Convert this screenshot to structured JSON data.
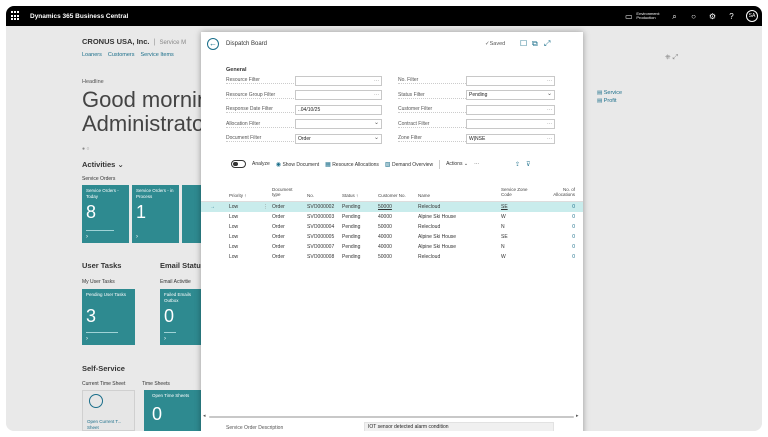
{
  "app": {
    "name": "Dynamics 365 Business Central",
    "environment_line1": "Environment:",
    "environment_line2": "Production",
    "avatar": "SA"
  },
  "background": {
    "company": "CRONUS USA, Inc.",
    "crumb": "Service M",
    "nav": [
      "Loaners",
      "Customers",
      "Service Items"
    ],
    "headline_label": "Headline",
    "greeting_line1": "Good mornin",
    "greeting_line2": "Administrator",
    "dots": "● ○",
    "activities": "Activities",
    "service_orders": "Service Orders",
    "tiles_service": [
      {
        "label": "Service Orders - Today",
        "value": "8"
      },
      {
        "label": "Service Orders - in Process",
        "value": "1"
      }
    ],
    "user_tasks": "User Tasks",
    "my_user_tasks": "My User Tasks",
    "pending_tile": {
      "label": "Pending User Tasks",
      "value": "3"
    },
    "email_status": "Email Statu",
    "email_activities": "Email Activitie",
    "failed_tile": {
      "label": "Failed Emails Outbox",
      "value": "0"
    },
    "self_service": "Self-Service",
    "current_time_sheet": "Current Time Sheet",
    "time_sheets": "Time Sheets",
    "open_current_tile": "Open Current T... Sheet",
    "open_time_tile": {
      "label": "Open Time Sheets",
      "value": "0"
    },
    "right_links": [
      "Service",
      "Profit"
    ]
  },
  "dispatch": {
    "title": "Dispatch Board",
    "saved": "✓Saved",
    "general": "General",
    "filters_left": [
      {
        "label": "Resource Filter",
        "value": "",
        "kind": "more"
      },
      {
        "label": "Resource Group Filter",
        "value": "",
        "kind": "more"
      },
      {
        "label": "Response Date Filter",
        "value": "..04/10/25",
        "kind": "none"
      },
      {
        "label": "Allocation Filter",
        "value": "",
        "kind": "dd"
      },
      {
        "label": "Document Filter",
        "value": "Order",
        "kind": "dd"
      }
    ],
    "filters_right": [
      {
        "label": "No. Filter",
        "value": "",
        "kind": "more"
      },
      {
        "label": "Status Filter",
        "value": "Pending",
        "kind": "dd"
      },
      {
        "label": "Customer Filter",
        "value": "",
        "kind": "more"
      },
      {
        "label": "Contract Filter",
        "value": "",
        "kind": "more"
      },
      {
        "label": "Zone Filter",
        "value": "W|NSE",
        "kind": "more"
      }
    ],
    "actions": {
      "analyze": "Analyze",
      "show_document": "Show Document",
      "resource_allocations": "Resource Allocations",
      "demand_overview": "Demand Overview",
      "actions": "Actions",
      "more": "···"
    },
    "columns": {
      "priority": "Priority ↑",
      "doc_type": "Document type",
      "no": "No.",
      "status": "Status ↑",
      "customer_no": "Customer No.",
      "name": "Name",
      "zone": "Service Zone Code",
      "allocations": "No. of Allocations"
    },
    "rows": [
      {
        "priority": "Low",
        "type": "Order",
        "no": "SVO000002",
        "status": "Pending",
        "cust": "50000",
        "name": "Relecloud",
        "zone": "SE",
        "alloc": "0"
      },
      {
        "priority": "Low",
        "type": "Order",
        "no": "SVO000003",
        "status": "Pending",
        "cust": "40000",
        "name": "Alpine Ski House",
        "zone": "W",
        "alloc": "0"
      },
      {
        "priority": "Low",
        "type": "Order",
        "no": "SVO000004",
        "status": "Pending",
        "cust": "50000",
        "name": "Relecloud",
        "zone": "N",
        "alloc": "0"
      },
      {
        "priority": "Low",
        "type": "Order",
        "no": "SVO000005",
        "status": "Pending",
        "cust": "40000",
        "name": "Alpine Ski House",
        "zone": "SE",
        "alloc": "0"
      },
      {
        "priority": "Low",
        "type": "Order",
        "no": "SVO000007",
        "status": "Pending",
        "cust": "40000",
        "name": "Alpine Ski House",
        "zone": "N",
        "alloc": "0"
      },
      {
        "priority": "Low",
        "type": "Order",
        "no": "SVO000008",
        "status": "Pending",
        "cust": "50000",
        "name": "Relecloud",
        "zone": "W",
        "alloc": "0"
      }
    ],
    "desc_label": "Service Order Description",
    "desc_value": "IOT sensor detected alarm condition"
  }
}
